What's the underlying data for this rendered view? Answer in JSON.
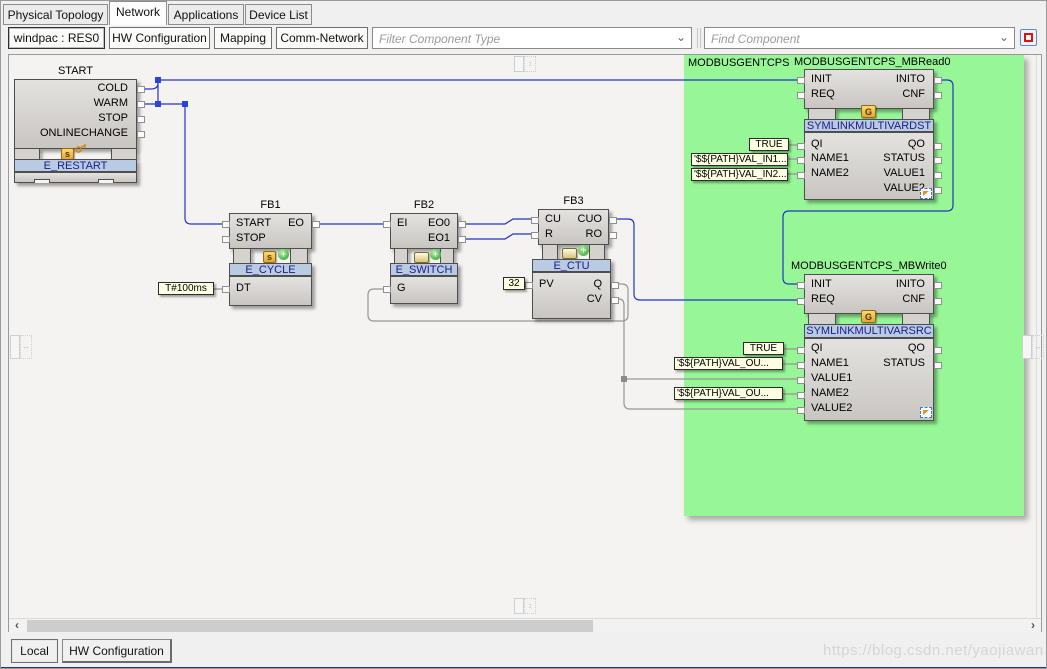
{
  "tabs": {
    "items": [
      {
        "label": "Physical Topology"
      },
      {
        "label": "Network"
      },
      {
        "label": "Applications"
      },
      {
        "label": "Device List"
      }
    ]
  },
  "toolbar": {
    "resource_button": "windpac : RES0",
    "hw_config_button": "HW Configuration",
    "mapping_button": "Mapping",
    "comm_network_button": "Comm-Network",
    "filter_placeholder": "Filter Component Type",
    "find_placeholder": "Find Component"
  },
  "group": {
    "label": "MODBUSGENTCPS"
  },
  "blocks": {
    "start": {
      "name": "START",
      "type": "E_RESTART",
      "ev_out": [
        "COLD",
        "WARM",
        "STOP",
        "ONLINECHANGE"
      ]
    },
    "fb1": {
      "name": "FB1",
      "type": "E_CYCLE",
      "ev_in": [
        "START",
        "STOP"
      ],
      "ev_out": [
        "EO"
      ],
      "data_in": [
        "DT"
      ],
      "dt_value": "T#100ms"
    },
    "fb2": {
      "name": "FB2",
      "type": "E_SWITCH",
      "ev_in": [
        "EI"
      ],
      "ev_out": [
        "EO0",
        "EO1"
      ],
      "data_in": [
        "G"
      ]
    },
    "fb3": {
      "name": "FB3",
      "type": "E_CTU",
      "ev_in": [
        "CU",
        "R"
      ],
      "ev_out": [
        "CUO",
        "RO"
      ],
      "data_in": [
        "PV"
      ],
      "data_out": [
        "Q",
        "CV"
      ],
      "pv_value": "32"
    },
    "mbread": {
      "name": "MODBUSGENTCPS_MBRead0",
      "type": "SYMLINKMULTIVARDST",
      "ev_in": [
        "INIT",
        "REQ"
      ],
      "ev_out": [
        "INITO",
        "CNF"
      ],
      "data_in": [
        "QI",
        "NAME1",
        "NAME2"
      ],
      "data_out": [
        "QO",
        "STATUS",
        "VALUE1",
        "VALUE2"
      ],
      "qi_value": "TRUE",
      "name1_value": "'$${PATH}VAL_IN1...",
      "name2_value": "'$${PATH}VAL_IN2..."
    },
    "mbwrite": {
      "name": "MODBUSGENTCPS_MBWrite0",
      "type": "SYMLINKMULTIVARSRC",
      "ev_in": [
        "INIT",
        "REQ"
      ],
      "ev_out": [
        "INITO",
        "CNF"
      ],
      "data_in": [
        "QI",
        "NAME1",
        "VALUE1",
        "NAME2",
        "VALUE2"
      ],
      "data_out": [
        "QO",
        "STATUS"
      ],
      "qi_value": "TRUE",
      "name1_value": "'$${PATH}VAL_OU...",
      "name2_value": "'$${PATH}VAL_OU..."
    }
  },
  "icons": {
    "chevron_down": "⌄",
    "scroll_left": "‹",
    "scroll_right": "›",
    "resize_h": "↔",
    "resize_v": "↕",
    "s_badge": "s",
    "g_badge": "G",
    "plus_badge": "+"
  },
  "bottom_tabs": {
    "items": [
      {
        "label": "Local"
      },
      {
        "label": "HW Configuration"
      }
    ]
  },
  "watermark": "https://blog.csdn.net/yaojiawan",
  "colors": {
    "event_line": "#2333c4",
    "data_line": "#969696",
    "group_fill": "#97f797",
    "banner_fill": "#b9cbe3",
    "value_fill": "#ffffe4",
    "record_red": "#dd1111"
  }
}
